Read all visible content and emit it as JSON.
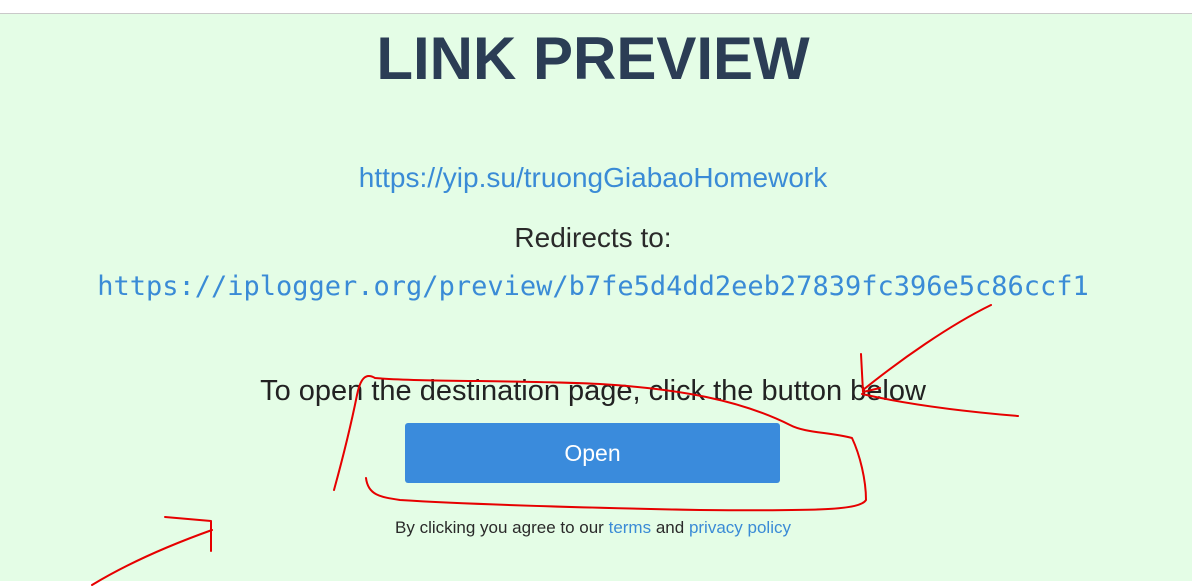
{
  "page": {
    "title": "LINK PREVIEW",
    "short_link": "https://yip.su/truongGiabaoHomework",
    "redirects_label": "Redirects to:",
    "destination_link": "https://iplogger.org/preview/b7fe5d4dd2eeb27839fc396e5c86ccf1",
    "instruction": "To open the destination page, click the button below",
    "open_button_label": "Open",
    "agree_prefix": "By clicking you agree to our",
    "terms_label": "terms",
    "and_label": "and",
    "privacy_label": "privacy policy"
  },
  "colors": {
    "background": "#e4fde6",
    "title": "#2b3d55",
    "link": "#3a8bd6",
    "button": "#3a8bdc",
    "annotation": "#e60000"
  }
}
